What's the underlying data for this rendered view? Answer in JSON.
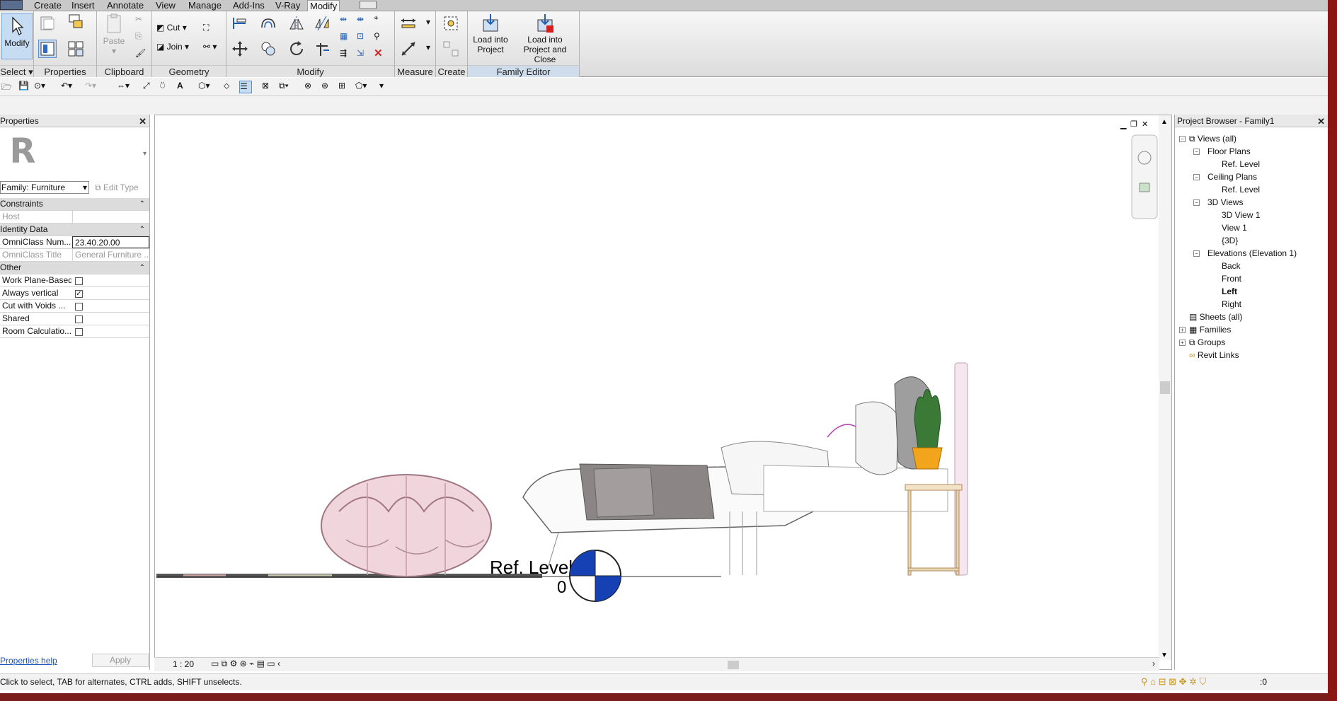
{
  "menu": {
    "tabs": [
      "Create",
      "Insert",
      "Annotate",
      "View",
      "Manage",
      "Add-Ins",
      "V-Ray",
      "Modify"
    ],
    "active": "Modify"
  },
  "ribbon": {
    "select": {
      "modify_label": "Modify",
      "panel_label": "Select"
    },
    "properties": {
      "panel_label": "Properties"
    },
    "clipboard": {
      "paste_label": "Paste",
      "panel_label": "Clipboard"
    },
    "geometry": {
      "cut_label": "Cut",
      "join_label": "Join",
      "panel_label": "Geometry"
    },
    "modify": {
      "panel_label": "Modify"
    },
    "measure": {
      "panel_label": "Measure"
    },
    "create": {
      "panel_label": "Create"
    },
    "family_editor": {
      "load_project_l1": "Load into",
      "load_project_l2": "Project",
      "load_close_l1": "Load into",
      "load_close_l2": "Project and Close",
      "panel_label": "Family Editor"
    }
  },
  "properties": {
    "title": "Properties",
    "logo_letter": "R",
    "family_combo": "Family: Furniture",
    "edit_type": "Edit Type",
    "rows": [
      {
        "type": "group",
        "label": "Constraints"
      },
      {
        "type": "field",
        "key": "Host",
        "value": "",
        "disabled": true
      },
      {
        "type": "group",
        "label": "Identity Data"
      },
      {
        "type": "field",
        "key": "OmniClass Num...",
        "value": "23.40.20.00"
      },
      {
        "type": "field",
        "key": "OmniClass Title",
        "value": "General Furniture ...",
        "disabled": true
      },
      {
        "type": "group",
        "label": "Other"
      },
      {
        "type": "check",
        "key": "Work Plane-Based",
        "checked": false
      },
      {
        "type": "check",
        "key": "Always vertical",
        "checked": true
      },
      {
        "type": "check",
        "key": "Cut with Voids ...",
        "checked": false
      },
      {
        "type": "check",
        "key": "Shared",
        "checked": false
      },
      {
        "type": "check",
        "key": "Room Calculatio...",
        "checked": false
      }
    ],
    "help_link": "Properties help",
    "apply": "Apply"
  },
  "canvas": {
    "level_name": "Ref. Level",
    "level_value": "0",
    "scale": "1 : 20"
  },
  "browser": {
    "title": "Project Browser - Family1",
    "views_all": "Views (all)",
    "floor_plans": "Floor Plans",
    "fp_ref": "Ref. Level",
    "ceiling_plans": "Ceiling Plans",
    "cp_ref": "Ref. Level",
    "views_3d": "3D Views",
    "v3d1": "3D View 1",
    "v1": "View 1",
    "v3d": "{3D}",
    "elevations": "Elevations (Elevation 1)",
    "back": "Back",
    "front": "Front",
    "left": "Left",
    "right": "Right",
    "sheets": "Sheets (all)",
    "families": "Families",
    "groups": "Groups",
    "revit_links": "Revit Links"
  },
  "status": {
    "text": "Click to select, TAB for alternates, CTRL adds, SHIFT unselects.",
    "filter_count": ":0"
  }
}
